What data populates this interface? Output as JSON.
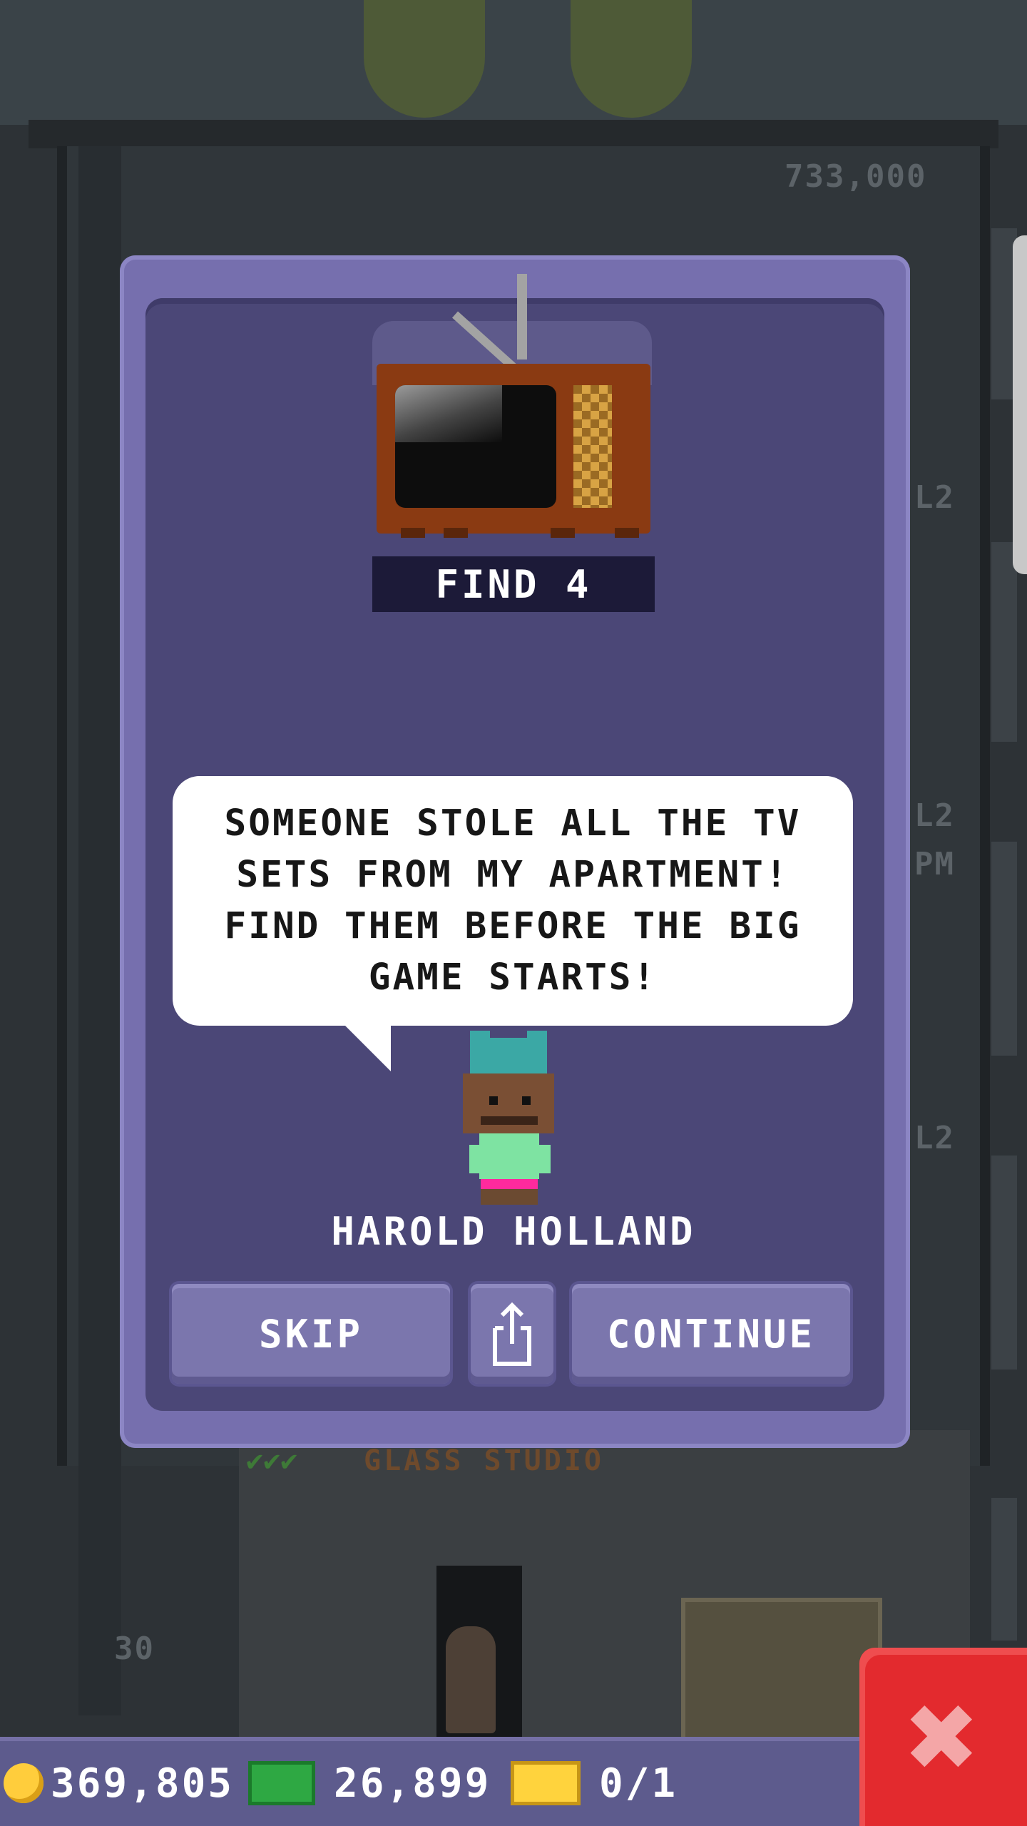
{
  "background": {
    "floor_value": "733,000",
    "floor_levels": [
      "L2",
      "L2",
      "L2",
      "L2",
      "L2"
    ],
    "floor_number": "30",
    "studio_name": "GLASS STUDIO",
    "time_label": "PM"
  },
  "mission": {
    "title": "FIND 4",
    "message": "SOMEONE STOLE ALL THE TV SETS FROM MY APARTMENT! FIND THEM BEFORE THE BIG GAME STARTS!",
    "character_name": "HAROLD HOLLAND"
  },
  "buttons": {
    "skip": "SKIP",
    "share_icon": "share-icon",
    "continue": "CONTINUE"
  },
  "hud": {
    "coins": "369,805",
    "bux": "26,899",
    "tickets": "0/1"
  },
  "close_icon": "close-icon",
  "colors": {
    "modal": "#766fae",
    "modal_inner": "#4b4777",
    "close": "#e32a2e",
    "coin": "#ffcd3c",
    "bux": "#2ea843"
  }
}
